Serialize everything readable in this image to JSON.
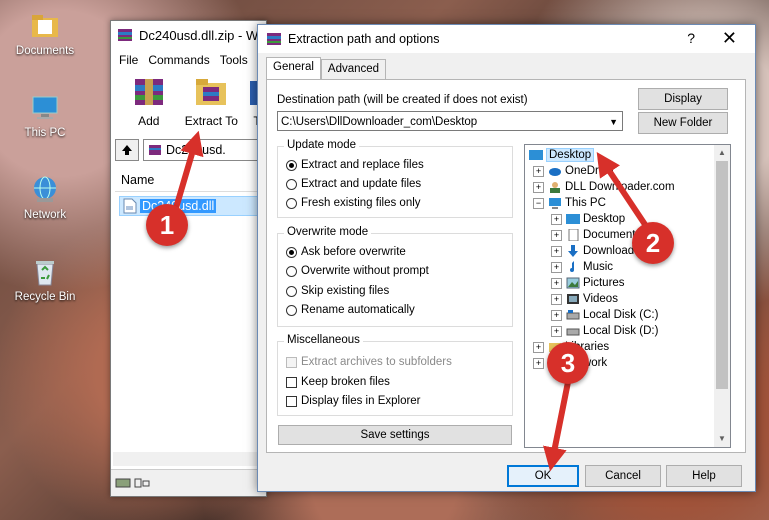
{
  "desktop": {
    "icons": [
      {
        "label": "Documents",
        "icon": "folder-documents-icon"
      },
      {
        "label": "This PC",
        "icon": "computer-icon"
      },
      {
        "label": "Network",
        "icon": "network-icon"
      },
      {
        "label": "Recycle Bin",
        "icon": "recycle-bin-icon"
      }
    ]
  },
  "winrar": {
    "title": "Dc240usd.dll.zip - W",
    "menu": [
      "File",
      "Commands",
      "Tools"
    ],
    "toolbar": {
      "add": "Add",
      "extract_to": "Extract To",
      "truncated": "T"
    },
    "path": "Dc240usd.",
    "column_name": "Name",
    "file": "Dc240usd.dll"
  },
  "dialog": {
    "title": "Extraction path and options",
    "help": "?",
    "close": "✕",
    "tabs": [
      "General",
      "Advanced"
    ],
    "dest_label": "Destination path (will be created if does not exist)",
    "dest_value": "C:\\Users\\DllDownloader_com\\Desktop",
    "btn_display": "Display",
    "btn_new_folder": "New Folder",
    "update_mode": {
      "title": "Update mode",
      "options": [
        "Extract and replace files",
        "Extract and update files",
        "Fresh existing files only"
      ],
      "selected": 0
    },
    "overwrite_mode": {
      "title": "Overwrite mode",
      "options": [
        "Ask before overwrite",
        "Overwrite without prompt",
        "Skip existing files",
        "Rename automatically"
      ],
      "selected": 0
    },
    "misc": {
      "title": "Miscellaneous",
      "options": [
        "Extract archives to subfolders",
        "Keep broken files",
        "Display files in Explorer"
      ]
    },
    "save_settings": "Save settings",
    "tree": [
      "Desktop",
      "OneDrive",
      "DLL Downloader.com",
      "This PC",
      "Desktop",
      "Documents",
      "Downloads",
      "Music",
      "Pictures",
      "Videos",
      "Local Disk (C:)",
      "Local Disk (D:)",
      "Libraries",
      "Network"
    ],
    "ok": "OK",
    "cancel": "Cancel",
    "help_btn": "Help"
  },
  "callouts": [
    "1",
    "2",
    "3"
  ],
  "colors": {
    "callout": "#d7302a",
    "selection": "#cce8ff",
    "accent": "#0078d7"
  }
}
